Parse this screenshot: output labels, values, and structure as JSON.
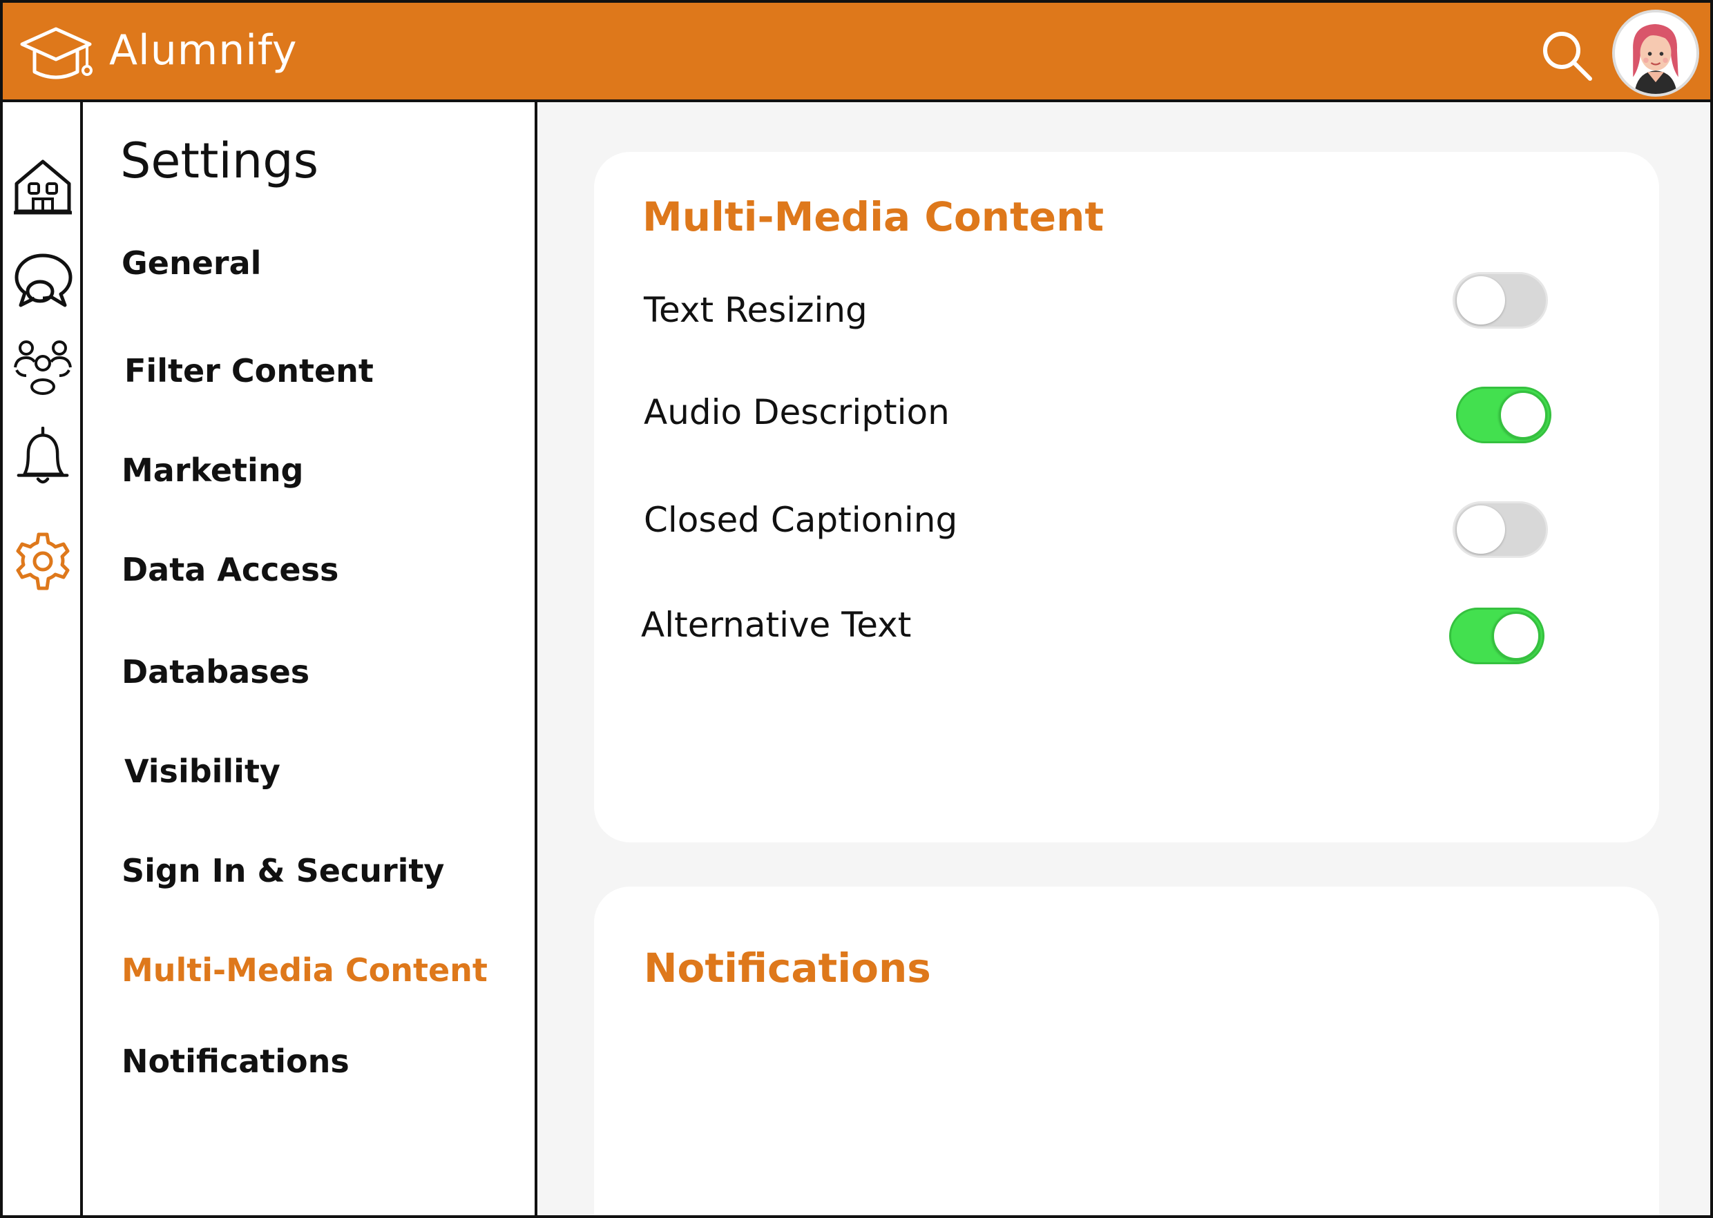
{
  "app": {
    "name": "Alumnify",
    "accent_color": "#de781b",
    "toggle_on_color": "#43e04f"
  },
  "header": {
    "search_icon": "search-icon",
    "avatar_icon": "user-avatar"
  },
  "rail": {
    "items": [
      {
        "icon": "home-icon"
      },
      {
        "icon": "chat-icon"
      },
      {
        "icon": "groups-icon"
      },
      {
        "icon": "bell-icon"
      },
      {
        "icon": "gear-icon",
        "active": true
      }
    ]
  },
  "menu": {
    "title": "Settings",
    "items": [
      {
        "label": "General"
      },
      {
        "label": "Filter Content"
      },
      {
        "label": "Marketing"
      },
      {
        "label": "Data Access"
      },
      {
        "label": "Databases"
      },
      {
        "label": "Visibility"
      },
      {
        "label": "Sign In & Security"
      },
      {
        "label": "Multi-Media Content",
        "active": true
      },
      {
        "label": "Notifications"
      }
    ]
  },
  "cards": {
    "multimedia": {
      "title": "Multi-Media Content",
      "settings": [
        {
          "label": "Text Resizing",
          "enabled": false
        },
        {
          "label": "Audio Description",
          "enabled": true
        },
        {
          "label": "Closed Captioning",
          "enabled": false
        },
        {
          "label": "Alternative Text",
          "enabled": true
        }
      ]
    },
    "notifications": {
      "title": "Notifications"
    }
  }
}
